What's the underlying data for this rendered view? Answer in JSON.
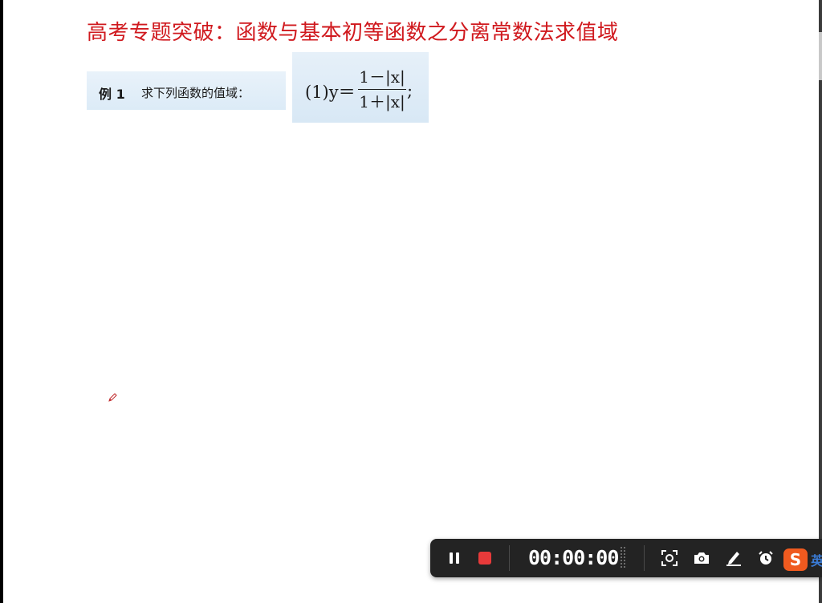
{
  "slide": {
    "title": "高考专题突破：函数与基本初等函数之分离常数法求值域",
    "example": {
      "label": "例 1",
      "prompt": "求下列函数的值域："
    },
    "formula": {
      "prefix": "(1)y＝",
      "numerator": "1－|x|",
      "denominator": "1＋|x|",
      "suffix": ";"
    }
  },
  "recorder_toolbar": {
    "elapsed_time": "00:00:00",
    "buttons": [
      {
        "name": "pause-button",
        "icon": "pause-icon"
      },
      {
        "name": "stop-button",
        "icon": "stop-icon",
        "color": "#e83a3a"
      },
      {
        "name": "region-screenshot-button",
        "icon": "region-capture-icon"
      },
      {
        "name": "camera-button",
        "icon": "camera-icon"
      },
      {
        "name": "annotate-pen-button",
        "icon": "pen-icon"
      },
      {
        "name": "scheduled-recording-button",
        "icon": "alarm-clock-icon"
      }
    ]
  },
  "ime": {
    "logo_letter": "S",
    "language": "英",
    "brand_color": "#ef5a1f"
  },
  "colors": {
    "title_red": "#d0191e",
    "toolbar_bg": "#232323",
    "box_blue": "#dcebf7"
  }
}
